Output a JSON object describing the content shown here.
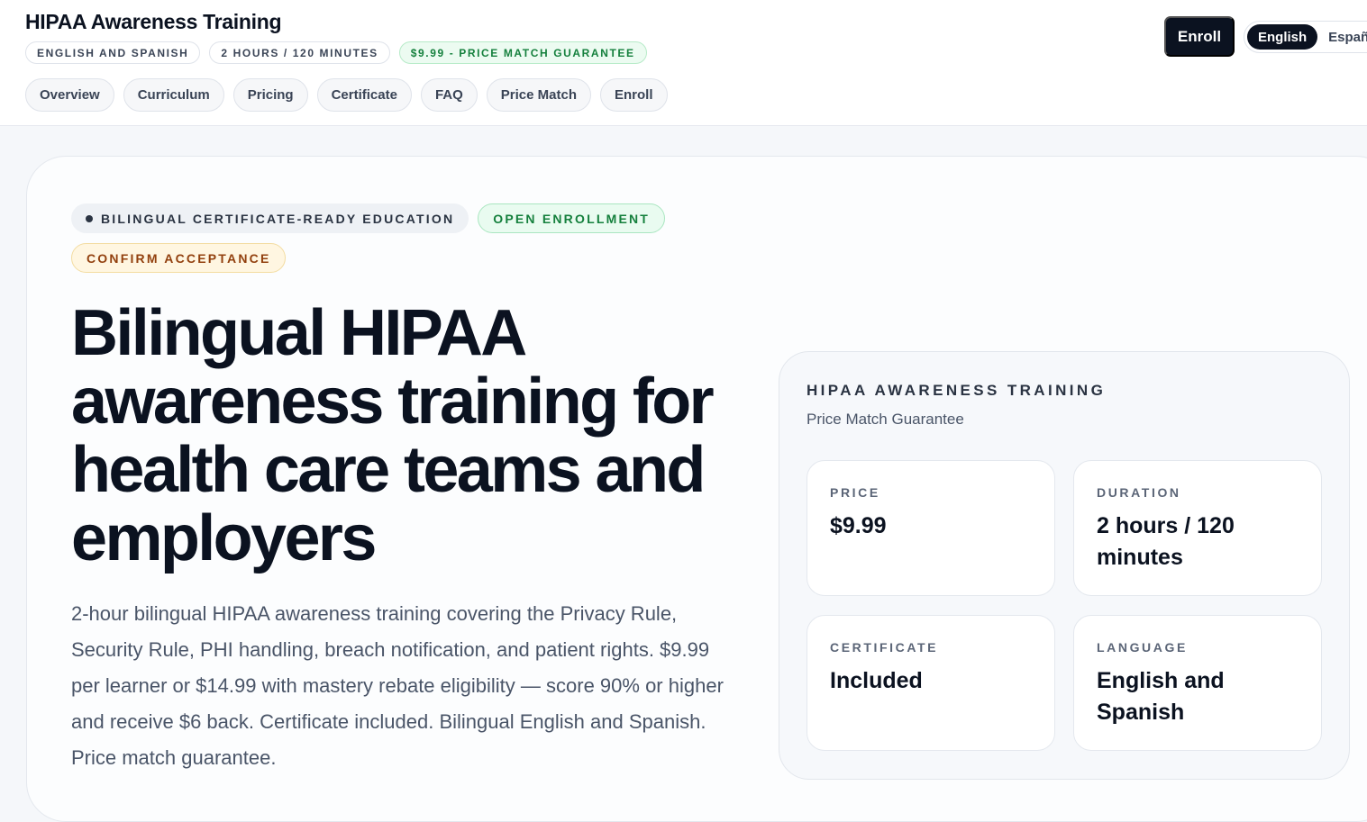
{
  "header": {
    "title": "HIPAA Awareness Training",
    "meta": {
      "languages": "ENGLISH AND SPANISH",
      "duration": "2 HOURS / 120 MINUTES",
      "price": "$9.99 - PRICE MATCH GUARANTEE"
    },
    "nav": [
      "Overview",
      "Curriculum",
      "Pricing",
      "Certificate",
      "FAQ",
      "Price Match",
      "Enroll"
    ],
    "enroll_label": "Enroll",
    "language_toggle": {
      "active": "English",
      "other": "Español"
    }
  },
  "hero": {
    "badges": {
      "eyebrow": "BILINGUAL CERTIFICATE-READY EDUCATION",
      "status": "OPEN ENROLLMENT",
      "notice": "CONFIRM ACCEPTANCE"
    },
    "headline": "Bilingual HIPAA awareness training for health care teams and employers",
    "description": "2-hour bilingual HIPAA awareness training covering the Privacy Rule, Security Rule, PHI handling, breach notification, and patient rights. $9.99 per learner or $14.99 with mastery rebate eligibility — score 90% or higher and receive $6 back. Certificate included. Bilingual English and Spanish. Price match guarantee."
  },
  "summary": {
    "eyebrow": "HIPAA AWARENESS TRAINING",
    "subtitle": "Price Match Guarantee",
    "stats": [
      {
        "label": "PRICE",
        "value": "$9.99"
      },
      {
        "label": "DURATION",
        "value": "2 hours / 120 minutes"
      },
      {
        "label": "CERTIFICATE",
        "value": "Included"
      },
      {
        "label": "LANGUAGE",
        "value": "English and Spanish"
      }
    ]
  },
  "colors": {
    "ink": "#0b1220",
    "success": "#15803d",
    "warning": "#92400e"
  }
}
